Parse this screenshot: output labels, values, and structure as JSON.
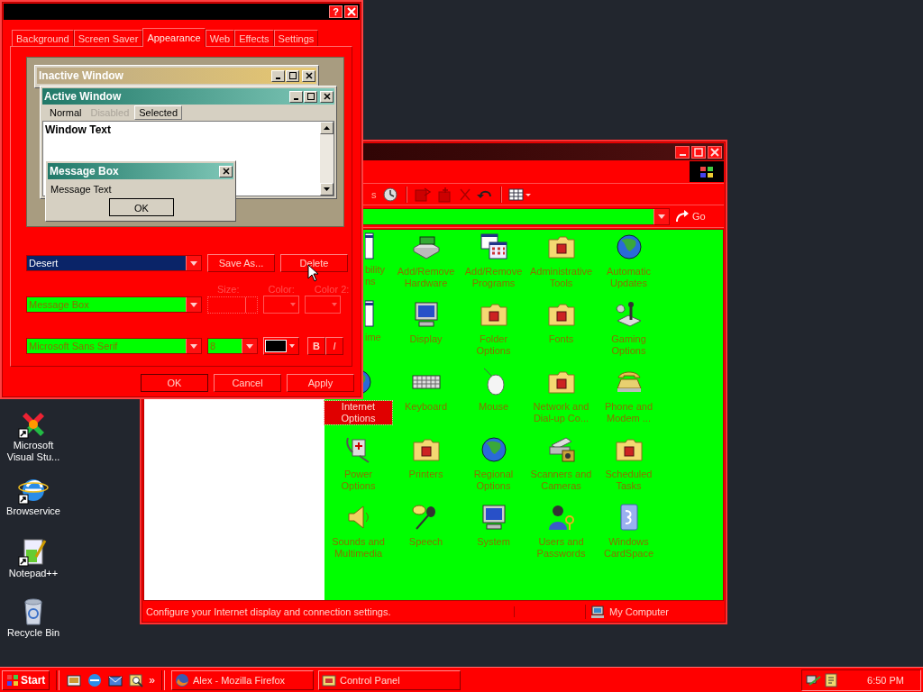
{
  "display_properties": {
    "help_button": "?",
    "tabs": [
      {
        "label": "Background",
        "selected": false
      },
      {
        "label": "Screen Saver",
        "selected": false
      },
      {
        "label": "Appearance",
        "selected": true
      },
      {
        "label": "Web",
        "selected": false
      },
      {
        "label": "Effects",
        "selected": false
      },
      {
        "label": "Settings",
        "selected": false
      }
    ],
    "preview": {
      "inactive_title": "Inactive Window",
      "active_title": "Active Window",
      "menu": [
        {
          "label": "Normal",
          "disabled": false,
          "selected": false
        },
        {
          "label": "Disabled",
          "disabled": true,
          "selected": false
        },
        {
          "label": "Selected",
          "disabled": false,
          "selected": true
        }
      ],
      "window_text": "Window Text",
      "message_box": {
        "title": "Message Box",
        "text": "Message Text",
        "button": "OK"
      }
    },
    "scheme": {
      "value": "Desert",
      "buttons": [
        "Save As...",
        "Delete"
      ]
    },
    "item_labels": [
      {
        "label": "Size:",
        "disabled": true
      },
      {
        "label": "Color:",
        "disabled": true
      },
      {
        "label": "Color 2:",
        "disabled": true
      }
    ],
    "item": {
      "value": "Message Box"
    },
    "font": {
      "value": "Microsoft Sans Serif",
      "size": "8"
    },
    "style_buttons": [
      "B",
      "I"
    ],
    "buttons": [
      "OK",
      "Cancel",
      "Apply"
    ]
  },
  "control_panel": {
    "toolbar_fragment": "s",
    "go_label": "Go",
    "items": [
      {
        "label": "bility ns",
        "partial": true,
        "selected": false
      },
      {
        "label": "Add/Remove Hardware",
        "partial": false,
        "selected": false
      },
      {
        "label": "Add/Remove Programs",
        "partial": false,
        "selected": false
      },
      {
        "label": "Administrative Tools",
        "partial": false,
        "selected": false
      },
      {
        "label": "Automatic Updates",
        "partial": false,
        "selected": false
      },
      {
        "label": "ime",
        "partial": true,
        "selected": false
      },
      {
        "label": "Display",
        "partial": false,
        "selected": false
      },
      {
        "label": "Folder Options",
        "partial": false,
        "selected": false
      },
      {
        "label": "Fonts",
        "partial": false,
        "selected": false
      },
      {
        "label": "Gaming Options",
        "partial": false,
        "selected": false
      },
      {
        "label": "Internet Options",
        "partial": false,
        "selected": true
      },
      {
        "label": "Keyboard",
        "partial": false,
        "selected": false
      },
      {
        "label": "Mouse",
        "partial": false,
        "selected": false
      },
      {
        "label": "Network and Dial-up Co...",
        "partial": false,
        "selected": false
      },
      {
        "label": "Phone and Modem ...",
        "partial": false,
        "selected": false
      },
      {
        "label": "Power Options",
        "partial": false,
        "selected": false
      },
      {
        "label": "Printers",
        "partial": false,
        "selected": false
      },
      {
        "label": "Regional Options",
        "partial": false,
        "selected": false
      },
      {
        "label": "Scanners and Cameras",
        "partial": false,
        "selected": false
      },
      {
        "label": "Scheduled Tasks",
        "partial": false,
        "selected": false
      },
      {
        "label": "Sounds and Multimedia",
        "partial": false,
        "selected": false
      },
      {
        "label": "Speech",
        "partial": false,
        "selected": false
      },
      {
        "label": "System",
        "partial": false,
        "selected": false
      },
      {
        "label": "Users and Passwords",
        "partial": false,
        "selected": false
      },
      {
        "label": "Windows CardSpace",
        "partial": false,
        "selected": false
      }
    ],
    "status_bar": {
      "text": "Configure your Internet display and connection settings.",
      "zone": "My Computer"
    }
  },
  "desktop_icons": [
    {
      "label": "Microsoft Visual Stu...",
      "shortcut": true
    },
    {
      "label": "Browservice",
      "shortcut": true
    },
    {
      "label": "Notepad++",
      "shortcut": true
    },
    {
      "label": "Recycle Bin",
      "shortcut": false
    }
  ],
  "taskbar": {
    "start": "Start",
    "chevron": "»",
    "tasks": [
      {
        "label": "Alex - Mozilla Firefox",
        "active": false
      },
      {
        "label": "Control Panel",
        "active": false
      }
    ],
    "clock": "6:50 PM"
  }
}
